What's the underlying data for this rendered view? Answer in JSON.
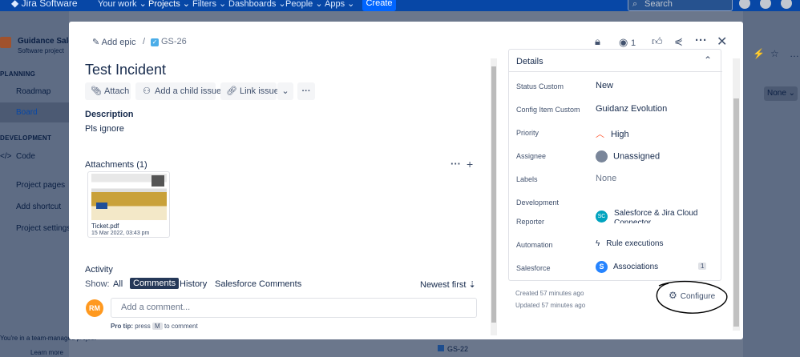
{
  "topbar": {
    "app_name": "Jira Software",
    "nav": [
      "Your work",
      "Projects",
      "Filters",
      "Dashboards",
      "People",
      "Apps"
    ],
    "create_label": "Create",
    "search_placeholder": "Search"
  },
  "sidebar": {
    "project_name": "Guidance Sales",
    "project_type": "Software project",
    "planning_heading": "PLANNING",
    "roadmap": "Roadmap",
    "board": "Board",
    "development_heading": "DEVELOPMENT",
    "code": "Code",
    "project_pages": "Project pages",
    "add_shortcut": "Add shortcut",
    "project_settings": "Project settings",
    "footer_note": "You're in a team-managed project",
    "learn_more": "Learn more"
  },
  "board_bg": {
    "group_by_value": "None",
    "card_key": "GS-22"
  },
  "modal": {
    "add_epic": "Add epic",
    "issue_key": "GS-26",
    "watch_count": "1",
    "title": "Test Incident",
    "actions": {
      "attach": "Attach",
      "add_child": "Add a child issue",
      "link_issue": "Link issue"
    },
    "description_heading": "Description",
    "description_text": "Pls ignore",
    "attachments_heading": "Attachments (1)",
    "attachment": {
      "name": "Ticket.pdf",
      "date": "15 Mar 2022, 03:43 pm"
    },
    "activity_heading": "Activity",
    "show_label": "Show:",
    "filters": [
      "All",
      "Comments",
      "History",
      "Salesforce Comments"
    ],
    "sort_label": "Newest first",
    "avatar_initials": "RM",
    "comment_placeholder": "Add a comment...",
    "pro_tip_bold": "Pro tip:",
    "pro_tip_press": "press",
    "pro_tip_key": "M",
    "pro_tip_rest": "to comment"
  },
  "details": {
    "heading": "Details",
    "fields": [
      {
        "label": "Status Custom",
        "value": "New"
      },
      {
        "label": "Config Item Custom",
        "value": "Guidanz Evolution"
      },
      {
        "label": "Priority",
        "value": "High"
      },
      {
        "label": "Assignee",
        "value": "Unassigned"
      },
      {
        "label": "Labels",
        "value": "None"
      },
      {
        "label": "Development",
        "value": ""
      },
      {
        "label": "Reporter",
        "value": "Salesforce & Jira Cloud Connector"
      },
      {
        "label": "Automation",
        "value": "Rule executions"
      },
      {
        "label": "Salesforce",
        "value": "Associations",
        "badge": "1"
      }
    ],
    "reporter_initials": "SC",
    "created": "Created 57 minutes ago",
    "updated": "Updated 57 minutes ago",
    "configure_label": "Configure"
  },
  "colors": {
    "brand": "#0052cc",
    "topbar": "#0747a6",
    "avatar_rm": "#ff991f",
    "priority_high": "#ff5630"
  }
}
